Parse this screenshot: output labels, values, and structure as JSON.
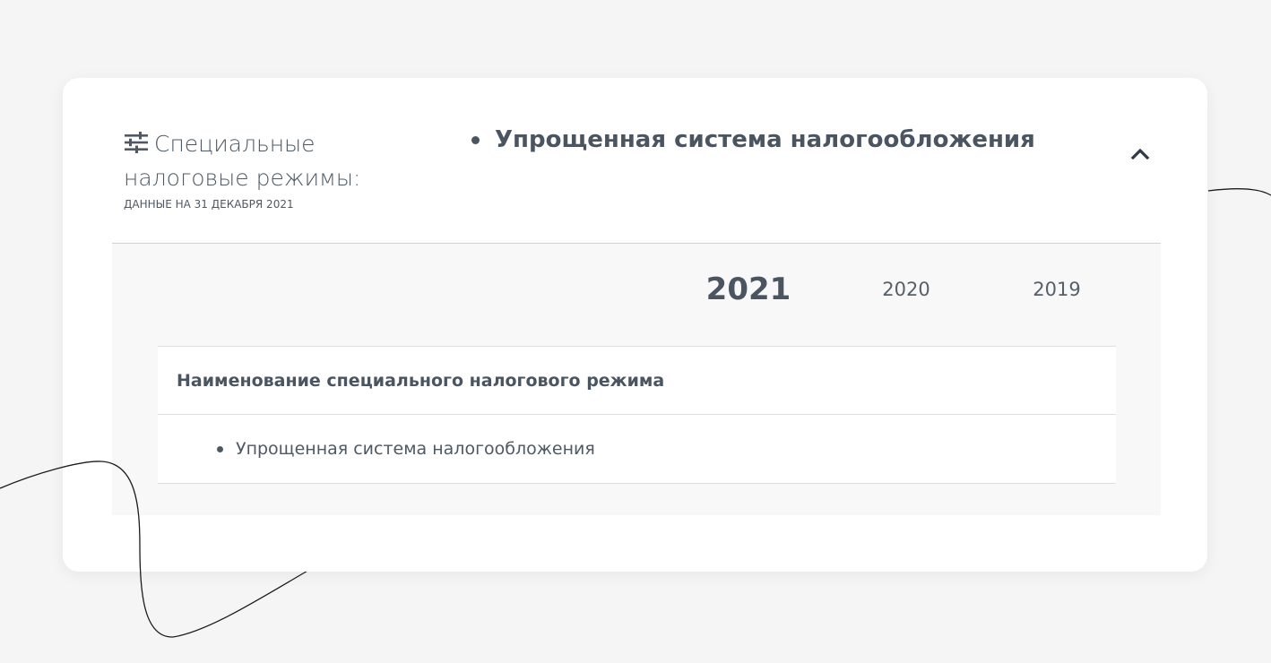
{
  "colors": {
    "page_background": "#f5f5f5",
    "card_background": "#ffffff",
    "panel_background": "#f8f8f8",
    "text_primary": "#4a5561",
    "divider": "#cfd2d6"
  },
  "header": {
    "icon": "filter-sliders-icon",
    "title_line1": "Специальные",
    "title_line2": "налоговые режимы:",
    "note": "ДАННЫЕ НА 31 ДЕКАБРЯ 2021",
    "summary_value": "Упрощенная система налогообложения",
    "collapse_icon": "chevron-up-icon"
  },
  "year_tabs": [
    {
      "label": "2021",
      "active": true
    },
    {
      "label": "2020",
      "active": false
    },
    {
      "label": "2019",
      "active": false
    }
  ],
  "table": {
    "header": "Наименование специального налогового режима",
    "rows": [
      {
        "value": "Упрощенная система налогообложения"
      }
    ]
  }
}
